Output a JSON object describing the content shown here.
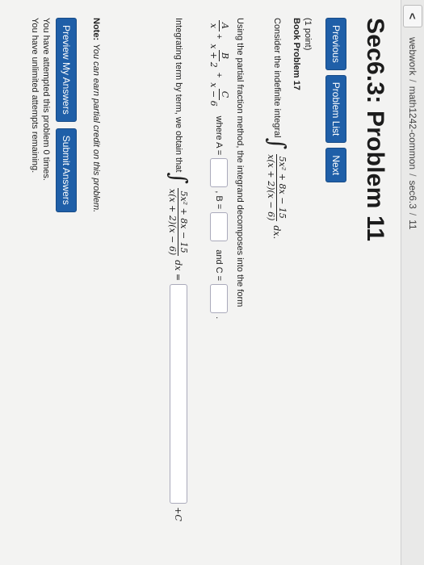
{
  "browser": {
    "back_glyph": "<",
    "breadcrumbs": [
      "webwork",
      "math1242-common",
      "sec6.3",
      "11"
    ],
    "sep": "/"
  },
  "page_title": "Sec6.3: Problem 11",
  "nav": {
    "previous": "Previous",
    "problem_list": "Problem List",
    "next": "Next"
  },
  "problem": {
    "points": "(1 point)",
    "book_problem": "Book Problem 17",
    "intro": "Consider the indefinite integral",
    "integrand_num": "5x² + 8x − 15",
    "integrand_den": "x(x + 2)(x − 6)",
    "dx": "dx.",
    "pf_instruction": "Using the partial fraction method, the integrand decomposes into the form",
    "pf_A_num": "A",
    "pf_A_den": "x",
    "pf_B_num": "B",
    "pf_B_den": "x + 2",
    "pf_C_num": "C",
    "pf_C_den": "x − 6",
    "plus": "+",
    "where_A": "where A =",
    "comma_B": ", B =",
    "and_C": "and C =",
    "period": ".",
    "integrate_text": "Integrating term by term, we obtain that",
    "dx_eq": "dx =",
    "plus_C": "+C"
  },
  "note": {
    "label": "Note:",
    "text": "You can earn partial credit on this problem."
  },
  "actions": {
    "preview": "Preview My Answers",
    "submit": "Submit Answers"
  },
  "status": {
    "attempted": "You have attempted this problem 0 times.",
    "remaining": "You have unlimited attempts remaining."
  }
}
